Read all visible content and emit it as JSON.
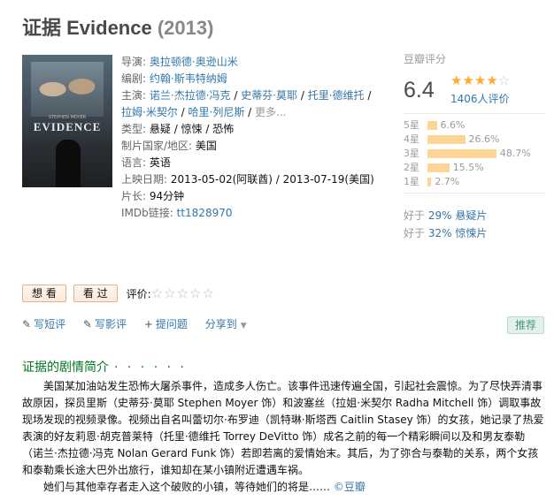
{
  "title": {
    "name": "证据 Evidence",
    "year": "(2013)"
  },
  "poster": {
    "tagline": "STEPHEN MOYER",
    "text": "EVIDENCE"
  },
  "info": {
    "director_label": "导演:",
    "director": "奥拉顿德·奥逊山米",
    "writer_label": "编剧:",
    "writer": "约翰·斯韦特纳姆",
    "cast_label": "主演:",
    "cast": [
      "诺兰·杰拉德·冯克",
      "史蒂芬·莫耶",
      "托里·德维托",
      "拉姆·米契尔",
      "哈里·列尼斯"
    ],
    "cast_sep": " / ",
    "cast_more": "更多...",
    "genre_label": "类型:",
    "genre": "悬疑 / 惊悚 / 恐怖",
    "country_label": "制片国家/地区:",
    "country": "美国",
    "language_label": "语言:",
    "language": "英语",
    "release_label": "上映日期:",
    "release": "2013-05-02(阿联酋) / 2013-07-19(美国)",
    "runtime_label": "片长:",
    "runtime": "94分钟",
    "imdb_label": "IMDb链接:",
    "imdb": "tt1828970"
  },
  "rating": {
    "title": "豆瓣评分",
    "score": "6.4",
    "stars_on": "★★★★",
    "stars_off": "☆",
    "votes": "1406人评价",
    "distribution": [
      {
        "label": "5星",
        "pct": "6.6%",
        "value": 6.6
      },
      {
        "label": "4星",
        "pct": "26.6%",
        "value": 26.6
      },
      {
        "label": "3星",
        "pct": "48.7%",
        "value": 48.7
      },
      {
        "label": "2星",
        "pct": "15.5%",
        "value": 15.5
      },
      {
        "label": "1星",
        "pct": "2.7%",
        "value": 2.7
      }
    ],
    "better1_prefix": "好于",
    "better1_pct": "29%",
    "better1_cat": "悬疑片",
    "better2_prefix": "好于",
    "better2_pct": "32%",
    "better2_cat": "惊悚片"
  },
  "actions": {
    "want": "想 看",
    "seen": "看 过",
    "rate_label": "评价:",
    "empty_stars": "☆☆☆☆☆"
  },
  "toolbar": {
    "short_review": "写短评",
    "long_review": "写影评",
    "ask": "提问题",
    "share": "分享到",
    "recommend": "推荐"
  },
  "summary": {
    "title": "证据的剧情简介",
    "dots": "· · · · · ·",
    "p1": "美国某加油站发生恐怖大屠杀事件，造成多人伤亡。该事件迅速传遍全国，引起社会震惊。为了尽快弄清事故原因，探员里斯（史蒂芬·莫耶 Stephen Moyer 饰）和波塞丝（拉姐·米契尔 Radha Mitchell 饰）调取事故现场发现的视频录像。视频出自名叫蕾切尔·布罗迪（凯特琳·斯塔西 Caitlin Stasey 饰）的女孩，她记录了热爱表演的好友莉恩·胡克普莱特（托里·德维托 Torrey DeVitto 饰）成名之前的每一个精彩瞬间以及和男友泰勒（诺兰·杰拉德·冯克 Nolan Gerard Funk 饰）若即若离的爱情始末。其后，为了弥合与泰勒的关系，两个女孩和泰勒乘长途大巴外出旅行，谁知却在某小镇附近遭遇车祸。",
    "p2": "她们与其他幸存者走入这个破败的小镇，等待她们的将是……",
    "copyright": "©豆瓣"
  },
  "colors": {
    "link": "#3377aa",
    "section_green": "#007722",
    "star_orange": "#ffac2d",
    "bar": "#ffd596"
  }
}
